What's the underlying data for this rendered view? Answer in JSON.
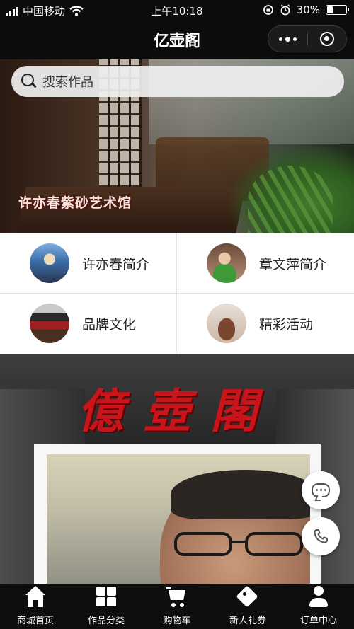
{
  "status_bar": {
    "carrier": "中国移动",
    "time": "上午10:18",
    "battery_percent": "30%",
    "battery_level": 0.3,
    "wifi_icon": "wifi-icon",
    "rotation_lock_icon": "rotation-lock-icon",
    "alarm_icon": "alarm-icon"
  },
  "navbar": {
    "title": "亿壶阁",
    "more_icon": "more-dots-icon",
    "close_icon": "target-circle-icon"
  },
  "hero": {
    "search_placeholder": "搜索作品",
    "caption": "许亦春紫砂艺术馆"
  },
  "menu": {
    "items": [
      {
        "label": "许亦春简介",
        "image": "portrait-xu-yichun"
      },
      {
        "label": "章文萍简介",
        "image": "portrait-zhang-wenping"
      },
      {
        "label": "品牌文化",
        "image": "brand-sign"
      },
      {
        "label": "精彩活动",
        "image": "teapot-activity"
      }
    ]
  },
  "brand_section": {
    "calligraphy": "億壺閣"
  },
  "floating": {
    "chat_icon": "chat-icon",
    "phone_icon": "phone-icon"
  },
  "tabbar": {
    "items": [
      {
        "label": "商城首页",
        "icon": "home-icon"
      },
      {
        "label": "作品分类",
        "icon": "grid-icon"
      },
      {
        "label": "购物车",
        "icon": "cart-icon"
      },
      {
        "label": "新人礼券",
        "icon": "tag-icon"
      },
      {
        "label": "订单中心",
        "icon": "user-icon"
      }
    ]
  },
  "colors": {
    "bar_bg": "#0c0c0c",
    "calligraphy_red": "#c8141a"
  }
}
